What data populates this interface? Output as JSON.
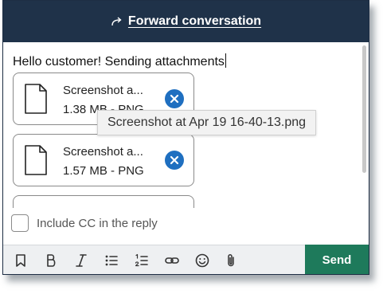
{
  "header": {
    "title": "Forward conversation",
    "icon": "forward-arrow-icon",
    "background": "#1f3249"
  },
  "composer": {
    "message": "Hello customer! Sending attachments"
  },
  "attachments": [
    {
      "name": "Screenshot a...",
      "meta": "1.38 MB - PNG",
      "icon": "file-icon",
      "remove_icon": "close-circle-icon"
    },
    {
      "name": "Screenshot a...",
      "meta": "1.57 MB - PNG",
      "icon": "file-icon",
      "remove_icon": "close-circle-icon"
    }
  ],
  "tooltip": {
    "text": "Screenshot at Apr 19 16-40-13.png"
  },
  "cc": {
    "label": "Include CC in the reply",
    "checked": false
  },
  "toolbar": {
    "tools": [
      "bookmark-icon",
      "bold-icon",
      "italic-icon",
      "bullet-list-icon",
      "numbered-list-icon",
      "link-icon",
      "emoji-icon",
      "paperclip-icon"
    ],
    "send_label": "Send",
    "send_color": "#1e7a5b"
  }
}
